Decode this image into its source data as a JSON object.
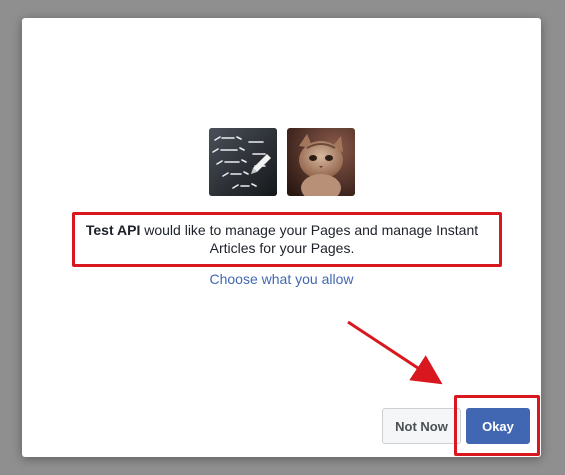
{
  "dialog": {
    "app_name": "Test API",
    "permission_text": " would like to manage your Pages and manage Instant Articles for your Pages.",
    "choose_link": "Choose what you allow",
    "buttons": {
      "not_now": "Not Now",
      "okay": "Okay"
    },
    "icons": {
      "app_thumbnail": "html-code-image",
      "page_thumbnail": "kitten-photo"
    }
  },
  "colors": {
    "accent": "#4267b2",
    "annotation": "#d9171e",
    "backdrop": "#8f8f8f"
  }
}
